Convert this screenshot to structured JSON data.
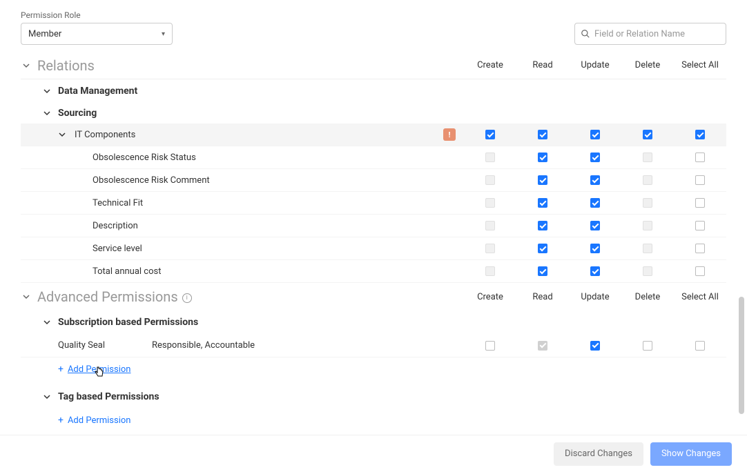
{
  "top": {
    "role_label": "Permission Role",
    "role_value": "Member",
    "search_placeholder": "Field or Relation Name"
  },
  "columns": {
    "create": "Create",
    "read": "Read",
    "update": "Update",
    "delete": "Delete",
    "select_all": "Select All"
  },
  "relations": {
    "title": "Relations",
    "groups": {
      "data_mgmt": "Data Management",
      "sourcing": "Sourcing"
    },
    "items": {
      "it_components": {
        "label": "IT Components",
        "badge": "!",
        "checks": {
          "create": true,
          "read": true,
          "update": true,
          "delete": true,
          "select_all": true
        }
      },
      "obs_status": {
        "label": "Obsolescence Risk Status",
        "checks": {
          "create": false,
          "read": true,
          "update": true,
          "delete": false,
          "select_all": false
        }
      },
      "obs_comment": {
        "label": "Obsolescence Risk Comment",
        "checks": {
          "create": false,
          "read": true,
          "update": true,
          "delete": false,
          "select_all": false
        }
      },
      "tech_fit": {
        "label": "Technical Fit",
        "checks": {
          "create": false,
          "read": true,
          "update": true,
          "delete": false,
          "select_all": false
        }
      },
      "description": {
        "label": "Description",
        "checks": {
          "create": false,
          "read": true,
          "update": true,
          "delete": false,
          "select_all": false
        }
      },
      "service_level": {
        "label": "Service level",
        "checks": {
          "create": false,
          "read": true,
          "update": true,
          "delete": false,
          "select_all": false
        }
      },
      "total_cost": {
        "label": "Total annual cost",
        "checks": {
          "create": false,
          "read": true,
          "update": true,
          "delete": false,
          "select_all": false
        }
      }
    }
  },
  "advanced": {
    "title": "Advanced Permissions",
    "sub_based": "Subscription based Permissions",
    "quality_seal": {
      "label": "Quality Seal",
      "scope": "Responsible, Accountable",
      "checks": {
        "create": false,
        "read": true,
        "update": true,
        "delete": false,
        "select_all": false
      }
    },
    "tag_based": "Tag based Permissions",
    "add_permission": "Add Permission"
  },
  "footer": {
    "discard": "Discard Changes",
    "show": "Show Changes"
  }
}
